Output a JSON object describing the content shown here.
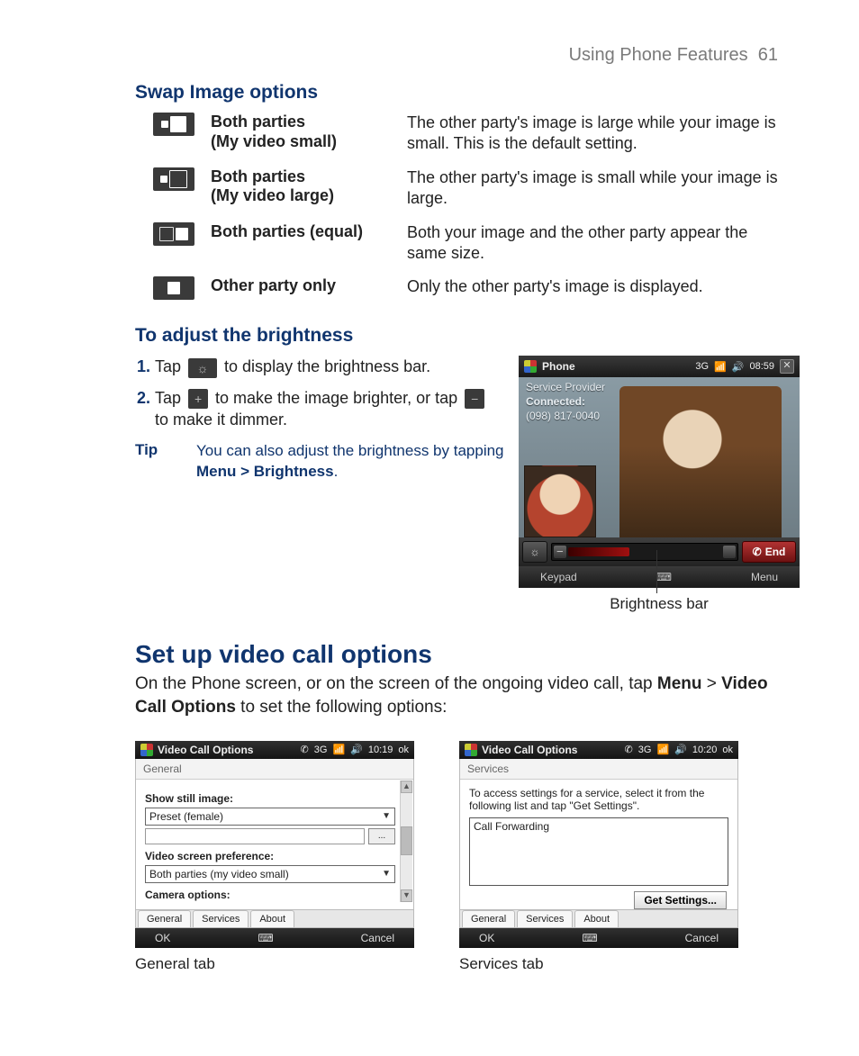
{
  "header": {
    "running": "Using Phone Features",
    "page": "61"
  },
  "swap": {
    "heading": "Swap Image options",
    "rows": [
      {
        "label1": "Both parties",
        "label2": "(My video small)",
        "desc": "The other party's image is large while your image is small. This is the default setting."
      },
      {
        "label1": "Both parties",
        "label2": "(My video large)",
        "desc": "The other party's image is small while your image is large."
      },
      {
        "label1": "Both parties (equal)",
        "label2": "",
        "desc": "Both your image and the other party appear the same size."
      },
      {
        "label1": "Other party only",
        "label2": "",
        "desc": "Only the other party's image is displayed."
      }
    ]
  },
  "brightness": {
    "heading": "To adjust the brightness",
    "step1_a": "Tap ",
    "step1_b": " to display the brightness bar.",
    "step2_a": "Tap ",
    "step2_b": " to make the image brighter, or tap ",
    "step2_c": " to make it dimmer.",
    "tip_label": "Tip",
    "tip_text_a": "You can also adjust the brightness by tapping ",
    "tip_menu": "Menu > Brightness",
    "tip_text_b": "."
  },
  "phone": {
    "title": "Phone",
    "indicators": "3G",
    "time": "08:59",
    "provider": "Service Provider",
    "status": "Connected:",
    "number": "(098) 817-0040",
    "end": "End",
    "soft_left": "Keypad",
    "soft_right": "Menu",
    "callout": "Brightness bar"
  },
  "setup": {
    "heading": "Set up video call options",
    "para_a": "On the Phone screen, or on the screen of the ongoing video call, tap ",
    "menu": "Menu",
    "gt": " > ",
    "opt": "Video Call Options",
    "para_b": " to set the following options:"
  },
  "dlg1": {
    "title": "Video Call Options",
    "time": "10:19",
    "ok": "ok",
    "tab": "General",
    "show_still": "Show still image:",
    "preset": "Preset (female)",
    "browse": "...",
    "pref": "Video screen preference:",
    "pref_val": "Both parties (my video small)",
    "cam": "Camera options:",
    "tabs": {
      "a": "General",
      "b": "Services",
      "c": "About"
    },
    "foot_left": "OK",
    "foot_right": "Cancel",
    "caption": "General tab"
  },
  "dlg2": {
    "title": "Video Call Options",
    "time": "10:20",
    "ok": "ok",
    "tab": "Services",
    "hint": "To access settings for a service, select it from the following list and tap \"Get Settings\".",
    "item": "Call Forwarding",
    "get": "Get Settings...",
    "tabs": {
      "a": "General",
      "b": "Services",
      "c": "About"
    },
    "foot_left": "OK",
    "foot_right": "Cancel",
    "caption": "Services tab"
  }
}
